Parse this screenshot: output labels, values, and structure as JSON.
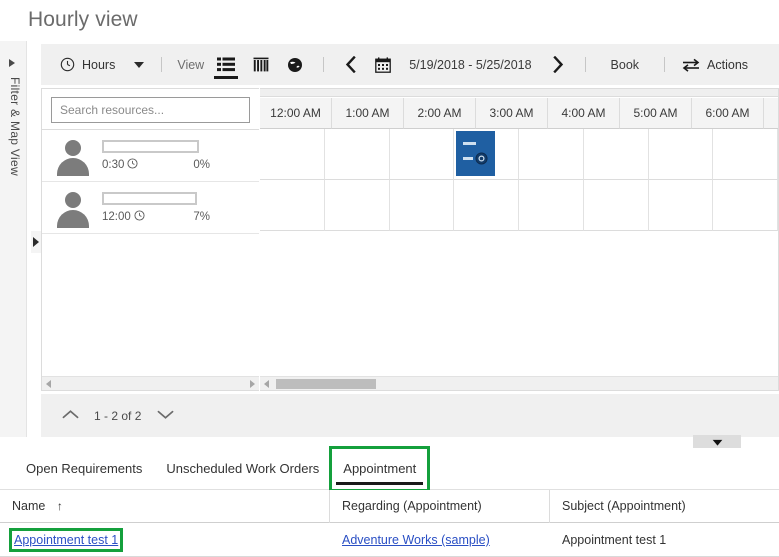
{
  "page": {
    "title": "Hourly view"
  },
  "left_rail": {
    "label": "Filter & Map View",
    "expand_icon": "triangle-right-icon"
  },
  "toolbar": {
    "unit_icon": "clock-icon",
    "unit_label": "Hours",
    "unit_caret": "caret-down-icon",
    "view_label": "View",
    "view_modes": [
      {
        "name": "list-view",
        "icon": "list-view-icon",
        "selected": true
      },
      {
        "name": "gantt-view",
        "icon": "gantt-columns-icon",
        "selected": false
      },
      {
        "name": "map-view",
        "icon": "globe-icon",
        "selected": false
      }
    ],
    "prev_icon": "chevron-left-icon",
    "calendar_icon": "calendar-icon",
    "date_range": "5/19/2018 - 5/25/2018",
    "next_icon": "chevron-right-icon",
    "book_label": "Book",
    "actions_icon": "swap-arrows-icon",
    "actions_label": "Actions"
  },
  "resources": {
    "search_placeholder": "Search resources...",
    "search_value": "",
    "rows": [
      {
        "avatar": "person-avatar",
        "name": "",
        "hours": "0:30",
        "clock_icon": "clock-icon",
        "utilization": "0%"
      },
      {
        "avatar": "person-avatar",
        "name": "",
        "hours": "12:00",
        "clock_icon": "clock-icon",
        "utilization": "7%"
      }
    ]
  },
  "calendar": {
    "hour_headers": [
      "12:00 AM",
      "1:00 AM",
      "2:00 AM",
      "3:00 AM",
      "4:00 AM",
      "5:00 AM",
      "6:00 AM"
    ],
    "row_count": 2,
    "appointment": {
      "row": 0,
      "column_index": 3,
      "color": "#1f5fa2",
      "icon": "appointment-badge-icon",
      "label": ""
    }
  },
  "pager": {
    "up_icon": "chevron-up-icon",
    "range_text": "1 - 2 of 2",
    "down_icon": "chevron-down-icon"
  },
  "collapse_handle": {
    "icon": "chevron-down-icon"
  },
  "side_handle": {
    "icon": "triangle-right-icon"
  },
  "tabs": [
    {
      "label": "Open Requirements",
      "active": false,
      "highlighted": false
    },
    {
      "label": "Unscheduled Work Orders",
      "active": false,
      "highlighted": false
    },
    {
      "label": "Appointment",
      "active": true,
      "highlighted": true
    }
  ],
  "grid": {
    "columns": [
      {
        "label": "Name",
        "sort_icon": "sort-ascending-icon",
        "sorted": true
      },
      {
        "label": "Regarding (Appointment)",
        "sort_icon": "",
        "sorted": false
      },
      {
        "label": "Subject (Appointment)",
        "sort_icon": "",
        "sorted": false
      }
    ],
    "rows": [
      {
        "name": "Appointment test 1",
        "name_is_link": true,
        "name_highlighted": true,
        "regarding": "Adventure Works (sample)",
        "regarding_is_link": true,
        "subject": "Appointment test 1"
      }
    ]
  },
  "colors": {
    "highlight_green": "#14a03c",
    "appointment_blue": "#1f5fa2",
    "link_blue": "#2a4fc4",
    "toolbar_bg": "#f0f0f0"
  }
}
